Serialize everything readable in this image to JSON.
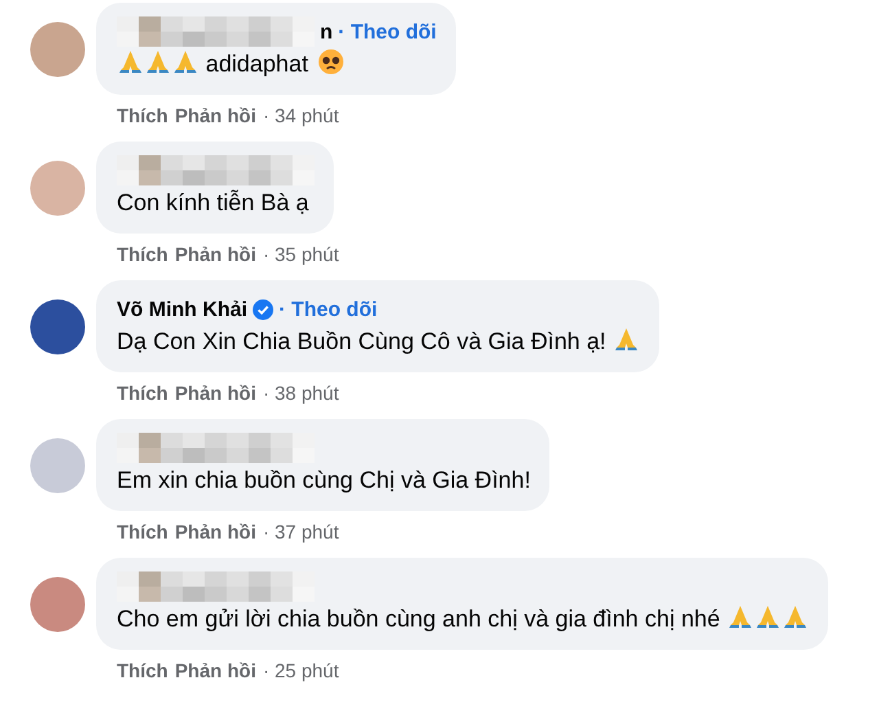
{
  "comments": [
    {
      "name": "n",
      "name_hidden": true,
      "follow": "· Theo dõi",
      "leading_icons": [
        {
          "kind": "pray"
        },
        {
          "kind": "pray"
        },
        {
          "kind": "pray"
        }
      ],
      "text": "adidaphat",
      "trailing_icons": [
        {
          "kind": "pleading"
        }
      ],
      "actions": {
        "like": "Thích",
        "reply": "Phản hồi",
        "time": "· 34 phút"
      }
    },
    {
      "name_hidden": true,
      "text": "Con kính tiễn Bà ạ",
      "actions": {
        "like": "Thích",
        "reply": "Phản hồi",
        "time": "· 35 phút"
      }
    },
    {
      "name": "Võ Minh Khải",
      "name_hidden": false,
      "verified": true,
      "follow": "· Theo dõi",
      "text": "Dạ Con Xin Chia Buồn Cùng Cô và Gia Đình ạ!",
      "trailing_icons": [
        {
          "kind": "pray"
        }
      ],
      "actions": {
        "like": "Thích",
        "reply": "Phản hồi",
        "time": "· 38 phút"
      }
    },
    {
      "name_hidden": true,
      "text": "Em xin chia buồn cùng Chị và Gia Đình!",
      "actions": {
        "like": "Thích",
        "reply": "Phản hồi",
        "time": "· 37 phút"
      }
    },
    {
      "name_hidden": true,
      "text": "Cho em gửi lời chia buồn cùng anh chị và gia đình chị nhé",
      "trailing_icons": [
        {
          "kind": "pray"
        },
        {
          "kind": "pray"
        },
        {
          "kind": "pray"
        }
      ],
      "actions": {
        "like": "Thích",
        "reply": "Phản hồi",
        "time": "· 25 phút"
      }
    }
  ]
}
